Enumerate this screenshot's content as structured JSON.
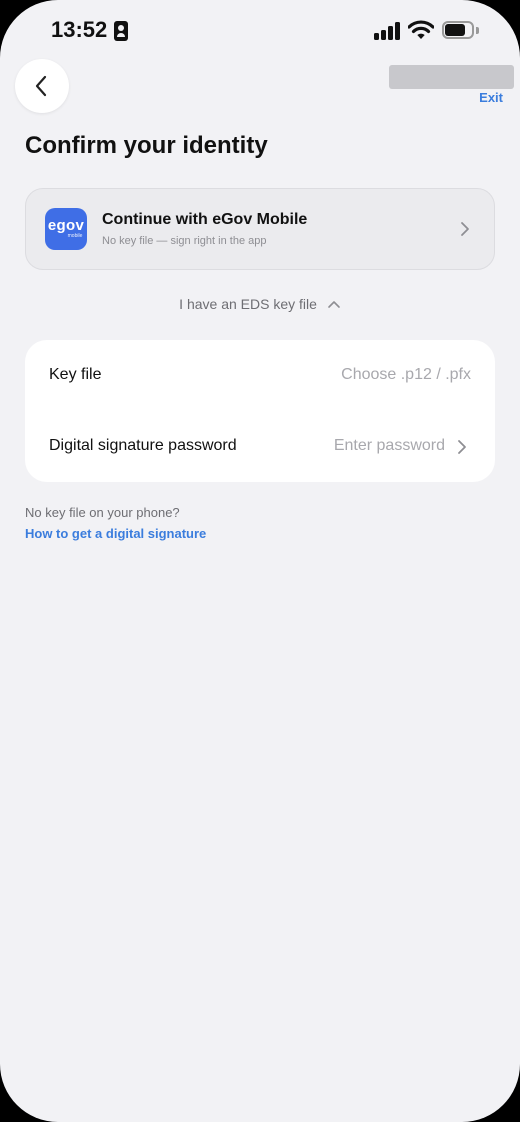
{
  "status_bar": {
    "time": "13:52",
    "icons": [
      "id-card-icon",
      "cellular-signal-icon",
      "wifi-icon",
      "battery-icon"
    ]
  },
  "header": {
    "back_icon": "chevron-left-icon",
    "exit_label": "Exit"
  },
  "page": {
    "title": "Confirm your identity"
  },
  "egov_option": {
    "logo_text": "egov",
    "logo_subtext": "mobile",
    "title": "Continue with eGov Mobile",
    "subtitle": "No key file — sign right in the app",
    "icon": "chevron-right-icon"
  },
  "eds_toggle": {
    "label": "I have an EDS key file",
    "icon": "chevron-up-icon"
  },
  "form": {
    "rows": [
      {
        "label": "Key file",
        "value": "Choose .p12 / .pfx"
      },
      {
        "label": "Digital signature password",
        "value": "Enter password",
        "icon": "chevron-right-icon"
      }
    ]
  },
  "help": {
    "hint": "No key file on your phone?",
    "link": "How to get a digital signature"
  },
  "colors": {
    "background": "#f2f2f5",
    "accent": "#3b7ddd",
    "egov_brand": "#3f6ee6",
    "placeholder": "#a8a8ad"
  }
}
